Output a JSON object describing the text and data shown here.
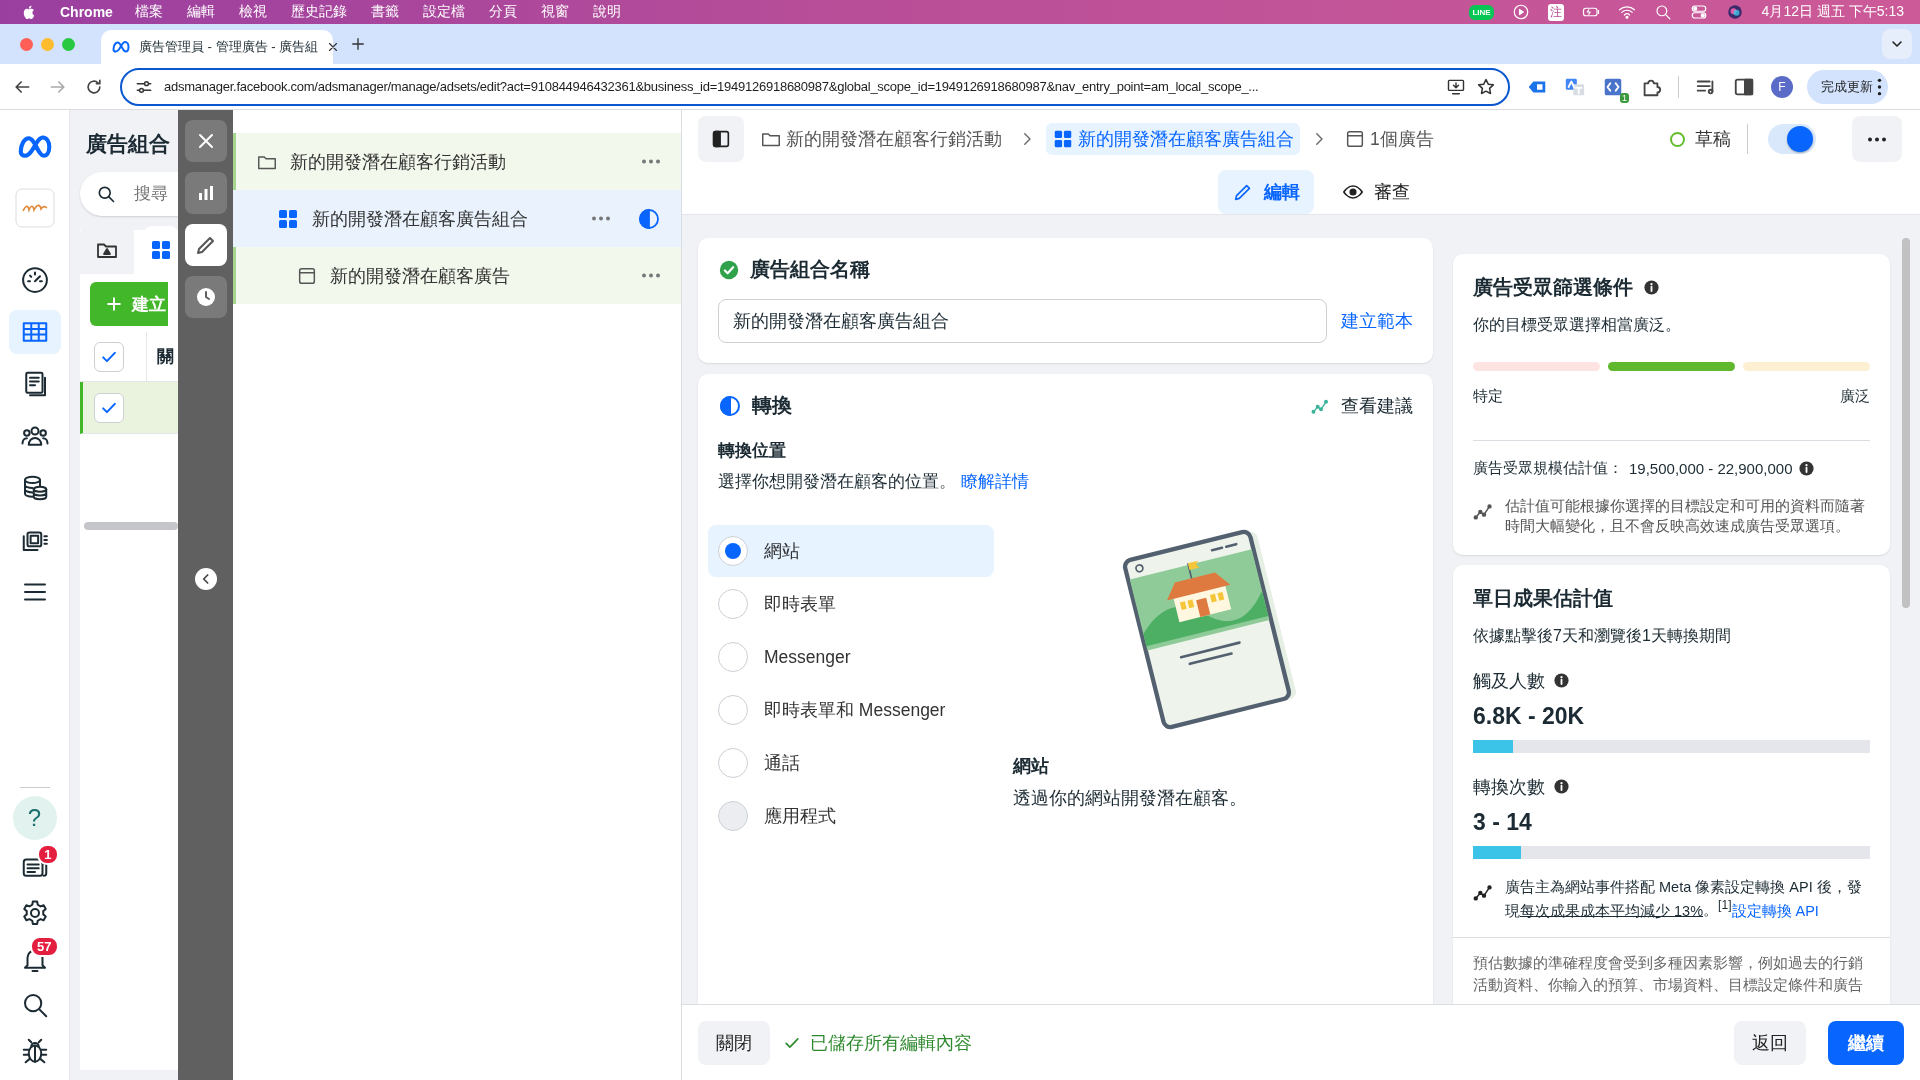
{
  "menubar": {
    "app": "Chrome",
    "menus": [
      "檔案",
      "編輯",
      "檢視",
      "歷史記錄",
      "書籤",
      "設定檔",
      "分頁",
      "視窗",
      "說明"
    ],
    "status_icons": [
      {
        "kind": "line",
        "text": "LINE"
      },
      {
        "kind": "play"
      },
      {
        "kind": "ime",
        "text": "注"
      },
      {
        "kind": "battery"
      },
      {
        "kind": "wifi"
      },
      {
        "kind": "search"
      },
      {
        "kind": "controls"
      },
      {
        "kind": "siri"
      }
    ],
    "clock": "4月12日 週五 下午5:13"
  },
  "browser": {
    "tab_title": "廣告管理員 - 管理廣告 - 廣告組",
    "url": "adsmanager.facebook.com/adsmanager/manage/adsets/edit?act=910844946432361&business_id=1949126918680987&global_scope_id=1949126918680987&nav_entry_point=am_local_scope_...",
    "extensions": [
      {
        "kind": "tag"
      },
      {
        "kind": "translate"
      },
      {
        "kind": "code",
        "badge": "1"
      },
      {
        "kind": "puzzle"
      }
    ],
    "profile": "F",
    "update_button": "完成更新"
  },
  "rail": {
    "items": [
      {
        "kind": "gauge",
        "selected": false
      },
      {
        "kind": "table",
        "selected": true
      },
      {
        "kind": "pages",
        "selected": false
      },
      {
        "kind": "people",
        "selected": false
      },
      {
        "kind": "coins",
        "selected": false
      },
      {
        "kind": "media",
        "selected": false
      },
      {
        "kind": "menu",
        "selected": false
      }
    ],
    "bottom": [
      {
        "kind": "help",
        "text": "?",
        "selected": true
      },
      {
        "kind": "news",
        "badge": "1",
        "selected": false
      },
      {
        "kind": "gear",
        "selected": false
      },
      {
        "kind": "bell",
        "badge": "57",
        "selected": false
      },
      {
        "kind": "search",
        "selected": false
      },
      {
        "kind": "bug",
        "selected": false
      }
    ]
  },
  "left_panel": {
    "title": "廣告組合",
    "search": {
      "placeholder": "搜尋"
    },
    "tabs": [
      {
        "kind": "folder",
        "selected": false
      },
      {
        "kind": "grid",
        "selected": true
      }
    ],
    "create_button": "建立",
    "header": {
      "checked": true,
      "column_1": "關"
    },
    "rows": [
      {
        "checked": true,
        "selected": true
      }
    ]
  },
  "toolbar": [
    {
      "kind": "close",
      "selected": false
    },
    {
      "kind": "chart",
      "selected": false
    },
    {
      "kind": "pencil",
      "selected": true
    },
    {
      "kind": "clock",
      "selected": false
    }
  ],
  "tree": [
    {
      "kind": "folder",
      "label": "新的開發潛在顧客行銷活動",
      "selected": false,
      "incomplete": false,
      "children": [
        {
          "kind": "grid",
          "label": "新的開發潛在顧客廣告組合",
          "selected": true,
          "incomplete": true,
          "children": [
            {
              "kind": "ad",
              "label": "新的開發潛在顧客廣告",
              "selected": false,
              "incomplete": false
            }
          ]
        }
      ]
    }
  ],
  "header": {
    "breadcrumbs": [
      {
        "kind": "folder",
        "label": "新的開發潛在顧客行銷活動",
        "selected": false
      },
      {
        "kind": "grid",
        "label": "新的開發潛在顧客廣告組合",
        "selected": true
      },
      {
        "kind": "ad",
        "label": "1個廣告",
        "selected": false
      }
    ],
    "status": "草稿",
    "toggle_on": true,
    "modes": [
      {
        "kind": "pencil",
        "label": "編輯",
        "selected": true
      },
      {
        "kind": "eye",
        "label": "審查",
        "selected": false
      }
    ]
  },
  "name_card": {
    "title": "廣告組合名稱",
    "complete": true,
    "value": "新的開發潛在顧客廣告組合",
    "link": "建立範本"
  },
  "conversion_card": {
    "title": "轉換",
    "link": "查看建議",
    "subtitle": "轉換位置",
    "description": "選擇你想開發潛在顧客的位置。",
    "learn_more": "瞭解詳情",
    "options": [
      {
        "label": "網站",
        "selected": true,
        "disabled": false
      },
      {
        "label": "即時表單",
        "selected": false,
        "disabled": false
      },
      {
        "label": "Messenger",
        "selected": false,
        "disabled": false
      },
      {
        "label": "即時表單和 Messenger",
        "selected": false,
        "disabled": false
      },
      {
        "label": "通話",
        "selected": false,
        "disabled": false
      },
      {
        "label": "應用程式",
        "selected": false,
        "disabled": true
      }
    ],
    "caption_title": "網站",
    "caption_text": "透過你的網站開發潛在顧客。"
  },
  "audience_card": {
    "title": "廣告受眾篩選條件",
    "summary": "你的目標受眾選擇相當廣泛。",
    "segments": [
      {
        "color": "#fde3e1"
      },
      {
        "color": "#5fb82e"
      },
      {
        "color": "#fdefd2"
      }
    ],
    "low_label": "特定",
    "high_label": "廣泛",
    "size_label": "廣告受眾規模估計值：",
    "size_value": "19,500,000 - 22,900,000",
    "note": "估計值可能根據你選擇的目標設定和可用的資料而隨著時間大幅變化，且不會反映高效速成廣告受眾選項。"
  },
  "results_card": {
    "title": "單日成果估計值",
    "subtitle": "依據點擊後7天和瀏覽後1天轉換期間",
    "metrics": [
      {
        "label": "觸及人數",
        "value": "6.8K - 20K",
        "level": 0.1
      },
      {
        "label": "轉換次數",
        "value": "3 - 14",
        "level": 0.12
      }
    ],
    "tip_before": "廣告主為網站事件搭配 Meta 像素設定轉換 API 後，發現",
    "tip_underlined": "每次成果成本平均減少 13%",
    "tip_after": "。$^{[1]}$",
    "tip_link": "設定轉換 API",
    "disclaimer": "預估數據的準確程度會受到多種因素影響，例如過去的行銷活動資料、你輸入的預算、市場資料、目標設定條件和廣告"
  },
  "footer": {
    "close": "關閉",
    "saved": "已儲存所有編輯內容",
    "back": "返回",
    "continue": "繼續"
  }
}
